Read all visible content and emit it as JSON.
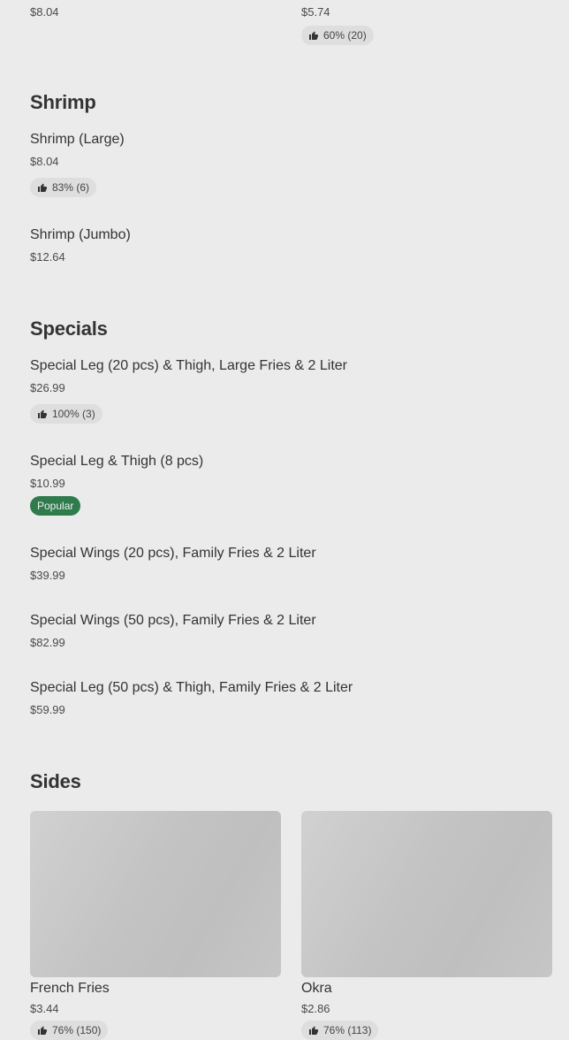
{
  "top_row": {
    "left": {
      "price": "$8.04"
    },
    "right": {
      "price": "$5.74",
      "rating": "60% (20)"
    }
  },
  "shrimp": {
    "title": "Shrimp",
    "items": [
      {
        "name": "Shrimp (Large)",
        "price": "$8.04",
        "rating": "83% (6)"
      },
      {
        "name": "Shrimp (Jumbo)",
        "price": "$12.64"
      }
    ]
  },
  "specials": {
    "title": "Specials",
    "items": [
      {
        "name": "Special Leg (20 pcs) & Thigh, Large Fries & 2 Liter",
        "price": "$26.99",
        "rating": "100% (3)"
      },
      {
        "name": "Special Leg & Thigh (8 pcs)",
        "price": "$10.99",
        "badge": "Popular"
      },
      {
        "name": "Special Wings (20 pcs), Family Fries & 2 Liter",
        "price": "$39.99"
      },
      {
        "name": "Special Wings (50 pcs), Family Fries & 2 Liter",
        "price": "$82.99"
      },
      {
        "name": "Special Leg (50 pcs) & Thigh, Family Fries & 2 Liter",
        "price": "$59.99"
      }
    ]
  },
  "sides": {
    "title": "Sides",
    "items": [
      {
        "name": "French Fries",
        "price": "$3.44",
        "rating": "76% (150)"
      },
      {
        "name": "Okra",
        "price": "$2.86",
        "rating": "76% (113)"
      }
    ]
  },
  "icons": {
    "rating": "thumbs-up-icon"
  },
  "colors": {
    "background": "#ebebeb",
    "popular_badge": "#2f7b4c",
    "rating_pill": "#dedede"
  }
}
